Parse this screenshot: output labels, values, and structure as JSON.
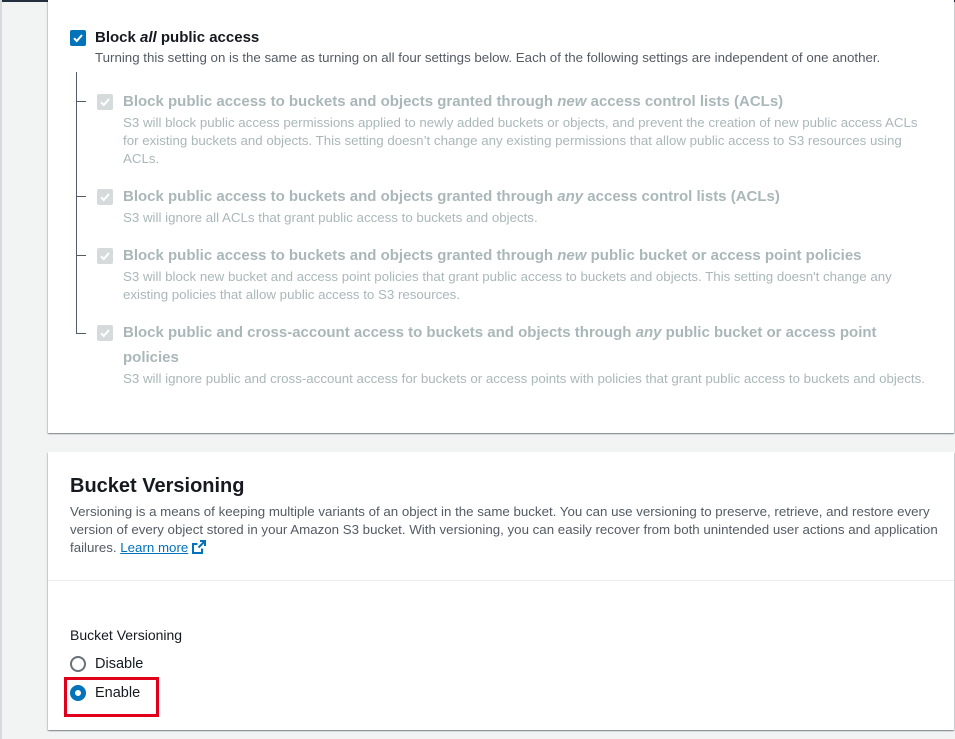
{
  "block_all": {
    "checked": true,
    "title_prefix": "Block ",
    "title_emph": "all",
    "title_suffix": " public access",
    "description": "Turning this setting on is the same as turning on all four settings below. Each of the following settings are independent of one another."
  },
  "sub_settings": [
    {
      "title_prefix": "Block public access to buckets and objects granted through ",
      "title_emph": "new",
      "title_suffix": " access control lists (ACLs)",
      "description": "S3 will block public access permissions applied to newly added buckets or objects, and prevent the creation of new public access ACLs for existing buckets and objects. This setting doesn’t change any existing permissions that allow public access to S3 resources using ACLs."
    },
    {
      "title_prefix": "Block public access to buckets and objects granted through ",
      "title_emph": "any",
      "title_suffix": " access control lists (ACLs)",
      "description": "S3 will ignore all ACLs that grant public access to buckets and objects."
    },
    {
      "title_prefix": "Block public access to buckets and objects granted through ",
      "title_emph": "new",
      "title_suffix": " public bucket or access point policies",
      "description": "S3 will block new bucket and access point policies that grant public access to buckets and objects. This setting doesn't change any existing policies that allow public access to S3 resources."
    },
    {
      "title_prefix": "Block public and cross-account access to buckets and objects through ",
      "title_emph": "any",
      "title_suffix": " public bucket or access point policies",
      "description": "S3 will ignore public and cross-account access for buckets or access points with policies that grant public access to buckets and objects."
    }
  ],
  "versioning": {
    "heading": "Bucket Versioning",
    "description": "Versioning is a means of keeping multiple variants of an object in the same bucket. You can use versioning to preserve, retrieve, and restore every version of every object stored in your Amazon S3 bucket. With versioning, you can easily recover from both unintended user actions and application failures.",
    "learn_more": "Learn more",
    "field_label": "Bucket Versioning",
    "options": [
      {
        "label": "Disable",
        "selected": false
      },
      {
        "label": "Enable",
        "selected": true
      }
    ]
  },
  "colors": {
    "accent": "#0073bb",
    "disabled": "#aab7b8",
    "highlight": "#e0001b"
  }
}
